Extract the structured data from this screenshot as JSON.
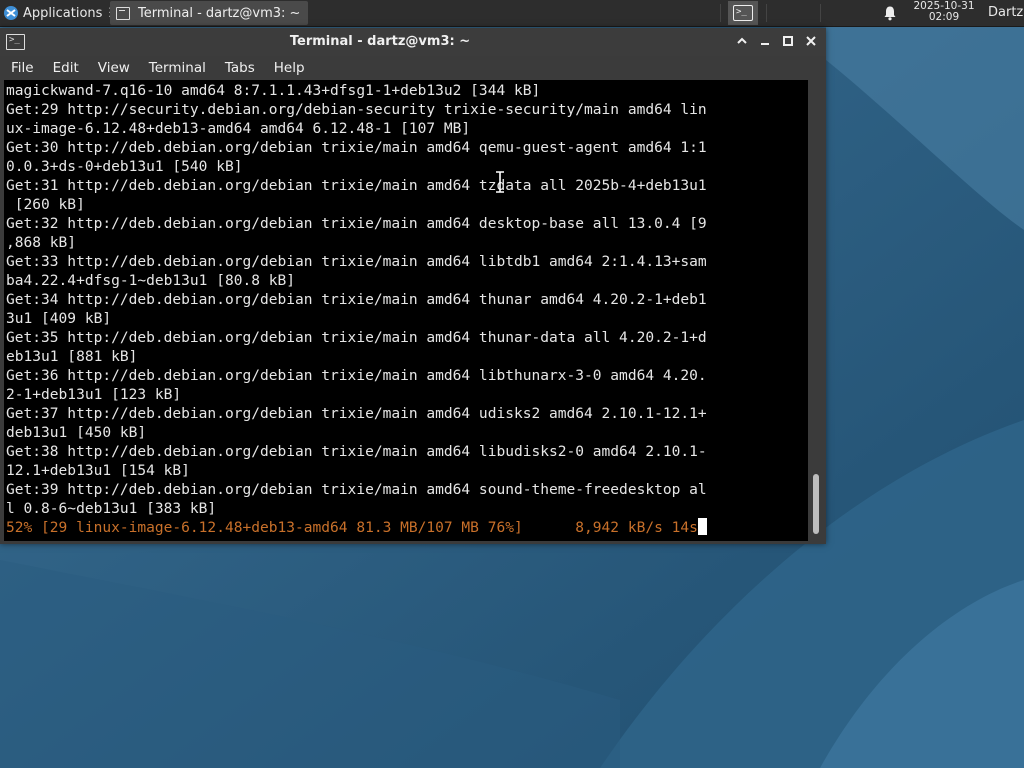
{
  "panel": {
    "applications_label": "Applications",
    "applications_sep": "☰",
    "task_title": "Terminal - dartz@vm3: ~",
    "clock_date": "2025-10-31",
    "clock_time": "02:09",
    "user": "Dartz"
  },
  "window": {
    "title": "Terminal - dartz@vm3: ~",
    "menu": [
      "File",
      "Edit",
      "View",
      "Terminal",
      "Tabs",
      "Help"
    ]
  },
  "terminal": {
    "lines": [
      "magickwand-7.q16-10 amd64 8:7.1.1.43+dfsg1-1+deb13u2 [344 kB]",
      "Get:29 http://security.debian.org/debian-security trixie-security/main amd64 lin",
      "ux-image-6.12.48+deb13-amd64 amd64 6.12.48-1 [107 MB]",
      "Get:30 http://deb.debian.org/debian trixie/main amd64 qemu-guest-agent amd64 1:1",
      "0.0.3+ds-0+deb13u1 [540 kB]",
      "Get:31 http://deb.debian.org/debian trixie/main amd64 tzdata all 2025b-4+deb13u1",
      " [260 kB]",
      "Get:32 http://deb.debian.org/debian trixie/main amd64 desktop-base all 13.0.4 [9",
      ",868 kB]",
      "Get:33 http://deb.debian.org/debian trixie/main amd64 libtdb1 amd64 2:1.4.13+sam",
      "ba4.22.4+dfsg-1~deb13u1 [80.8 kB]",
      "Get:34 http://deb.debian.org/debian trixie/main amd64 thunar amd64 4.20.2-1+deb1",
      "3u1 [409 kB]",
      "Get:35 http://deb.debian.org/debian trixie/main amd64 thunar-data all 4.20.2-1+d",
      "eb13u1 [881 kB]",
      "Get:36 http://deb.debian.org/debian trixie/main amd64 libthunarx-3-0 amd64 4.20.",
      "2-1+deb13u1 [123 kB]",
      "Get:37 http://deb.debian.org/debian trixie/main amd64 udisks2 amd64 2.10.1-12.1+",
      "deb13u1 [450 kB]",
      "Get:38 http://deb.debian.org/debian trixie/main amd64 libudisks2-0 amd64 2.10.1-",
      "12.1+deb13u1 [154 kB]",
      "Get:39 http://deb.debian.org/debian trixie/main amd64 sound-theme-freedesktop al",
      "l 0.8-6~deb13u1 [383 kB]"
    ],
    "status_line": "52% [29 linux-image-6.12.48+deb13-amd64 81.3 MB/107 MB 76%]      8,942 kB/s 14s",
    "text_color": "#e6e6e6",
    "status_color": "#c8702a",
    "background": "#000000"
  }
}
